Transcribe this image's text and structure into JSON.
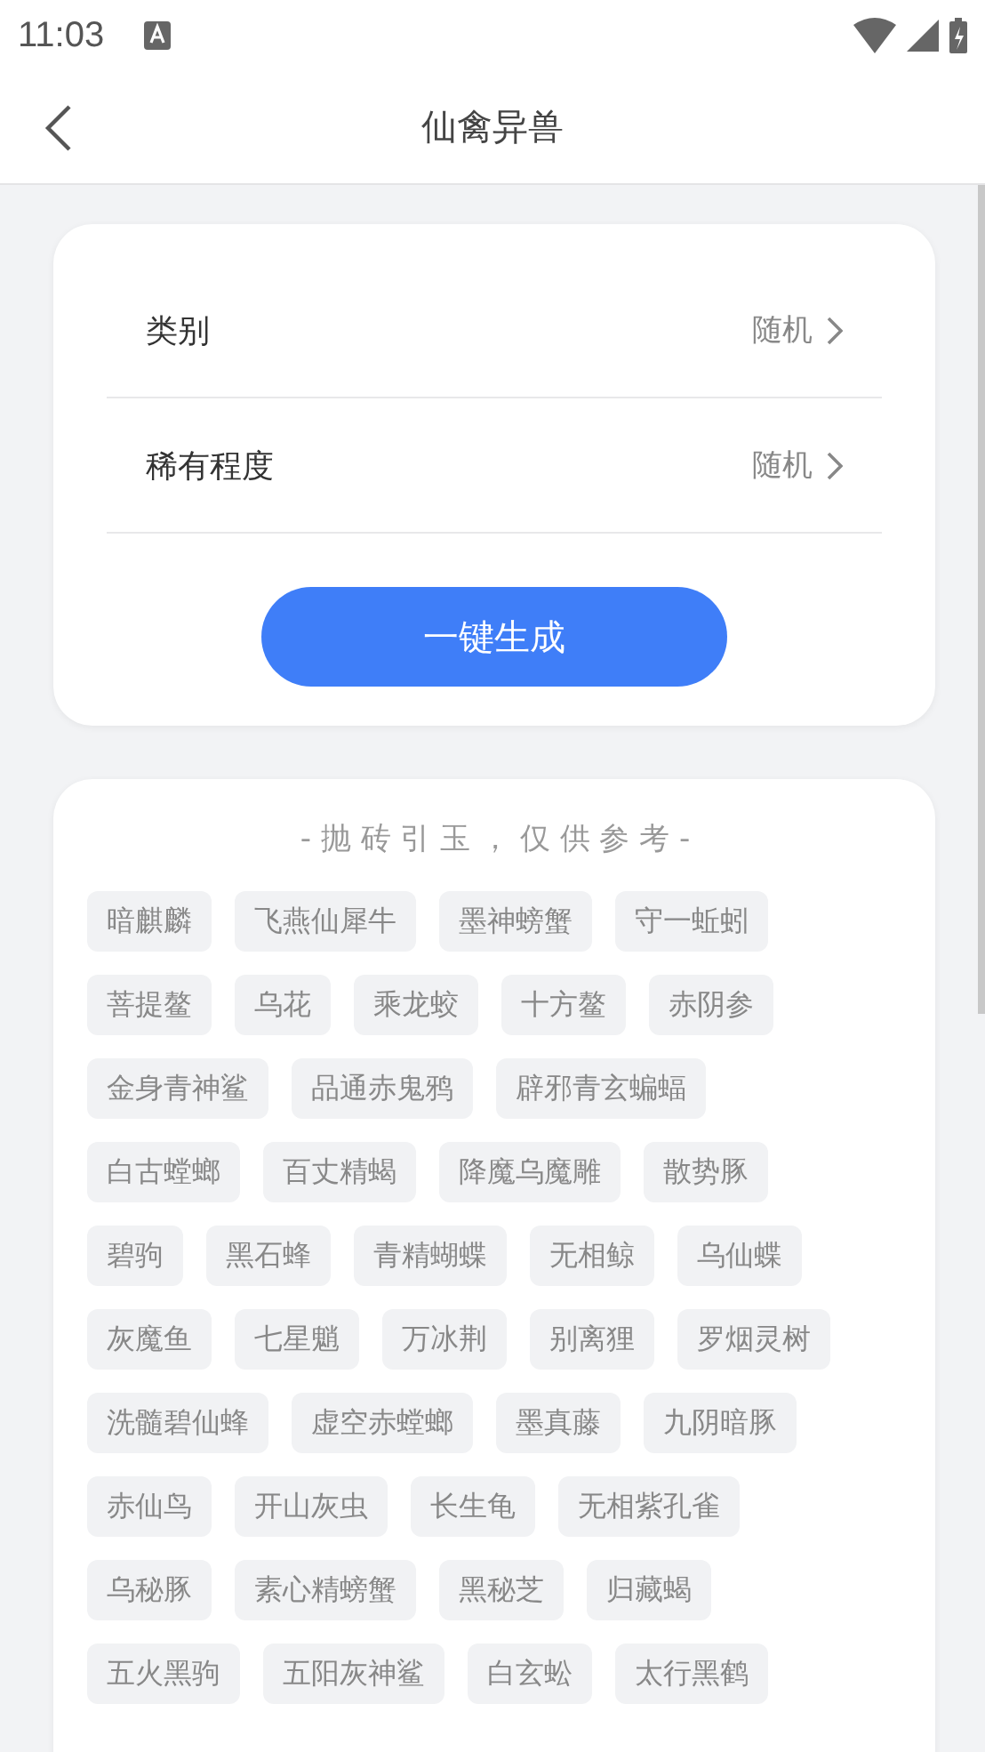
{
  "status_bar": {
    "time": "11:03"
  },
  "header": {
    "title": "仙禽异兽"
  },
  "options": [
    {
      "label": "类别",
      "value": "随机"
    },
    {
      "label": "稀有程度",
      "value": "随机"
    }
  ],
  "generate_button": "一键生成",
  "results": {
    "caption": "- 抛 砖 引 玉 ， 仅 供 参 考 -",
    "tags": [
      "暗麒麟",
      "飞燕仙犀牛",
      "墨神螃蟹",
      "守一蚯蚓",
      "菩提鳌",
      "乌花",
      "乘龙蛟",
      "十方鳌",
      "赤阴参",
      "金身青神鲨",
      "品通赤鬼鸦",
      "辟邪青玄蝙蝠",
      "白古螳螂",
      "百丈精蝎",
      "降魔乌魔雕",
      "散势豚",
      "碧驹",
      "黑石蜂",
      "青精蝴蝶",
      "无相鲸",
      "乌仙蝶",
      "灰魔鱼",
      "七星魈",
      "万冰荆",
      "别离狸",
      "罗烟灵树",
      "洗髓碧仙蜂",
      "虚空赤螳螂",
      "墨真藤",
      "九阴暗豚",
      "赤仙鸟",
      "开山灰虫",
      "长生龟",
      "无相紫孔雀",
      "乌秘豚",
      "素心精螃蟹",
      "黑秘芝",
      "归藏蝎",
      "五火黑驹",
      "五阳灰神鲨",
      "白玄蚣",
      "太行黑鹤"
    ]
  }
}
